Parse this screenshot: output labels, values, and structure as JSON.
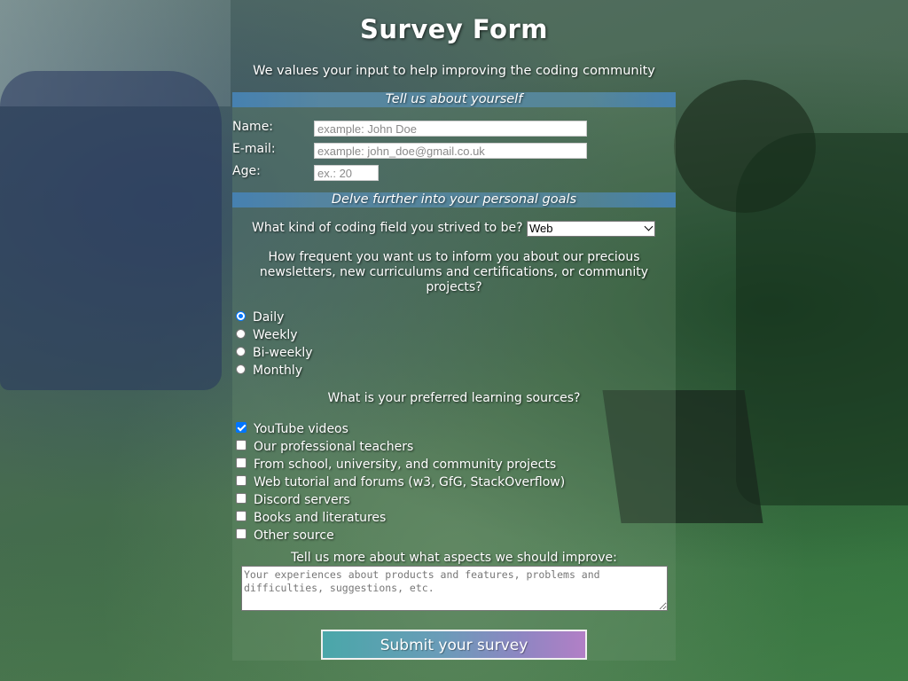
{
  "header": {
    "title": "Survey Form",
    "subtitle": "We values your input to help improving the coding community"
  },
  "section_about": {
    "heading": "Tell us about yourself",
    "name_label": "Name:",
    "name_placeholder": "example: John Doe",
    "email_label": "E-mail:",
    "email_placeholder": "example: john_doe@gmail.co.uk",
    "age_label": "Age:",
    "age_placeholder": "ex.: 20"
  },
  "section_goals": {
    "heading": "Delve further into your personal goals",
    "field_question": "What kind of coding field you strived to be?",
    "field_selected": "Web",
    "frequency_question": "How frequent you want us to inform you about our precious newsletters, new curriculums and certifications, or community projects?",
    "frequency_options": [
      {
        "label": "Daily",
        "selected": true
      },
      {
        "label": "Weekly",
        "selected": false
      },
      {
        "label": "Bi-weekly",
        "selected": false
      },
      {
        "label": "Monthly",
        "selected": false
      }
    ],
    "sources_question": "What is your preferred learning sources?",
    "sources_options": [
      {
        "label": "YouTube videos",
        "checked": true
      },
      {
        "label": "Our professional teachers",
        "checked": false
      },
      {
        "label": "From school, university, and community projects",
        "checked": false
      },
      {
        "label": "Web tutorial and forums (w3, GfG, StackOverflow)",
        "checked": false
      },
      {
        "label": "Discord servers",
        "checked": false
      },
      {
        "label": "Books and literatures",
        "checked": false
      },
      {
        "label": "Other source",
        "checked": false
      }
    ],
    "improve_question": "Tell us more about what aspects we should improve:",
    "improve_placeholder": "Your experiences about products and features, problems and difficulties, suggestions, etc."
  },
  "submit_label": "Submit your survey",
  "colors": {
    "section_bar": "#4682b4",
    "accent_blue": "#0075ff",
    "submit_start": "#4aa7a9",
    "submit_end": "#b27fc6"
  },
  "icons": {
    "select_arrow": "chevron-down-icon",
    "checkbox_mark": "check-icon"
  }
}
